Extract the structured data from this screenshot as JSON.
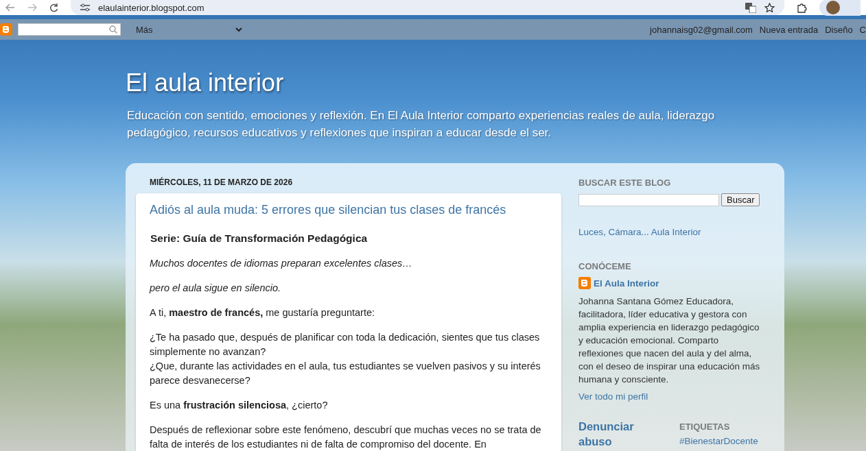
{
  "browser": {
    "url": "elaulainterior.blogspot.com"
  },
  "navbar": {
    "more_label": "Más",
    "links": [
      "johannaisg02@gmail.com",
      "Nueva entrada",
      "Diseño",
      "C"
    ]
  },
  "header": {
    "title": "El aula interior",
    "description": "Educación con sentido, emociones y reflexión. En El Aula Interior comparto experiencias reales de aula, liderazgo pedagógico, recursos educativos y reflexiones que inspiran a educar desde el ser."
  },
  "post": {
    "date": "MIÉRCOLES, 11 DE MARZO DE 2026",
    "title": "Adiós al aula muda: 5 errores que silencian tus clases de francés",
    "paragraphs": [
      {
        "kind": "heading",
        "lines": [
          "Serie: Guía de Transformación Pedagógica"
        ]
      },
      {
        "kind": "italic",
        "lines": [
          " Muchos docentes de idiomas preparan excelentes clases…"
        ]
      },
      {
        "kind": "italic",
        "lines": [
          "pero el aula sigue en silencio."
        ]
      },
      {
        "kind": "text",
        "lines": [
          "A ti, **maestro de francés,** me gustaría preguntarte:"
        ]
      },
      {
        "kind": "text",
        "lines": [
          "¿Te ha pasado que, después de planificar con toda la dedicación, sientes que tus clases simplemente no avanzan?",
          "¿Que, durante las actividades en el aula, tus estudiantes se vuelven pasivos y su interés parece desvanecerse?"
        ]
      },
      {
        "kind": "text",
        "lines": [
          "Es una **frustración silenciosa**, ¿cierto?"
        ]
      },
      {
        "kind": "text",
        "lines": [
          "Después de reflexionar sobre este fenómeno, descubrí que muchas veces no se trata de falta de interés de los estudiantes ni de falta de compromiso del docente. En"
        ]
      }
    ]
  },
  "sidebar": {
    "search": {
      "heading": "BUSCAR ESTE BLOG",
      "button": "Buscar"
    },
    "page_link": "Luces, Cámara... Aula Interior",
    "profile": {
      "heading": "CONÓCEME",
      "name": "El Aula Interior",
      "bio": "Johanna Santana Gómez Educadora, facilitadora, líder educativa y gestora con amplia experiencia en liderazgo pedagógico y educación emocional. Comparto reflexiones que nacen del aula y del alma, con el deseo de inspirar una educación más humana y consciente.",
      "link": "Ver todo mi perfil"
    },
    "report": {
      "heading": "Denunciar abuso"
    },
    "labels": {
      "heading": "ETIQUETAS",
      "items": [
        "#BienestarDocente"
      ]
    }
  }
}
